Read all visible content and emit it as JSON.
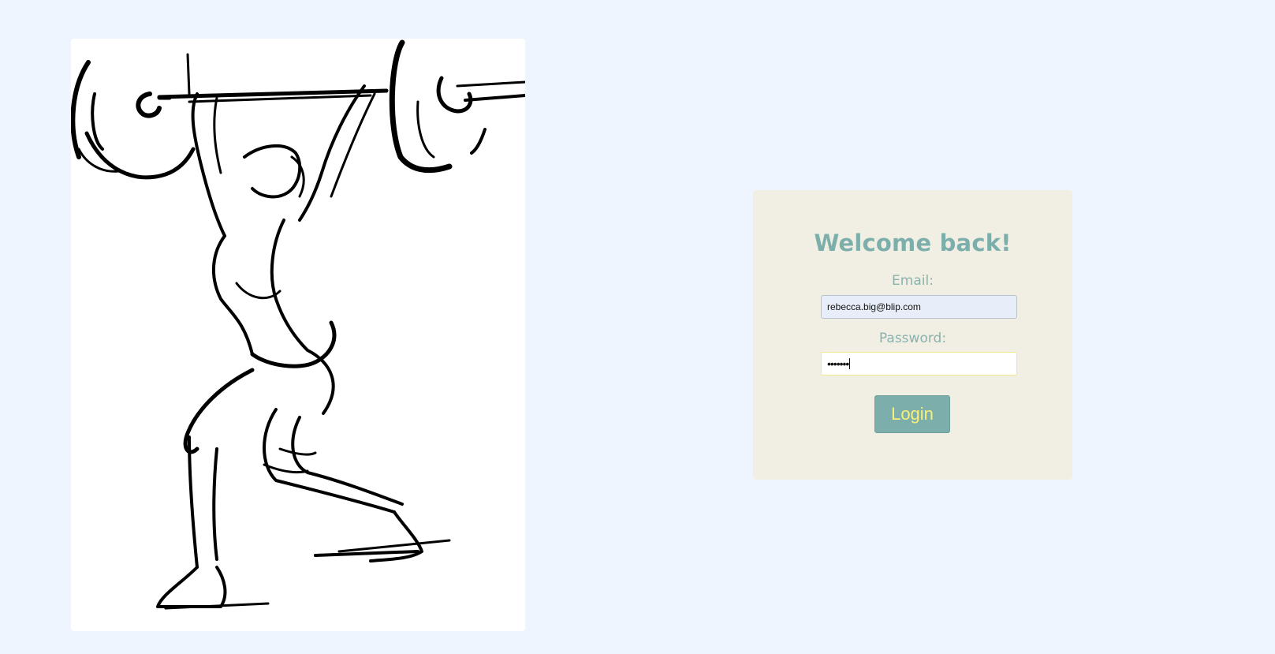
{
  "illustration": {
    "subject": "weightlifter-line-art"
  },
  "login": {
    "heading": "Welcome back!",
    "email_label": "Email:",
    "email_value": "rebecca.big@blip.com",
    "password_label": "Password:",
    "password_value": "•••••••",
    "button_label": "Login"
  },
  "colors": {
    "page_background": "#eef5fe",
    "card_background": "#f1efe4",
    "accent": "#7cafab",
    "button_text": "#f7f07a"
  }
}
